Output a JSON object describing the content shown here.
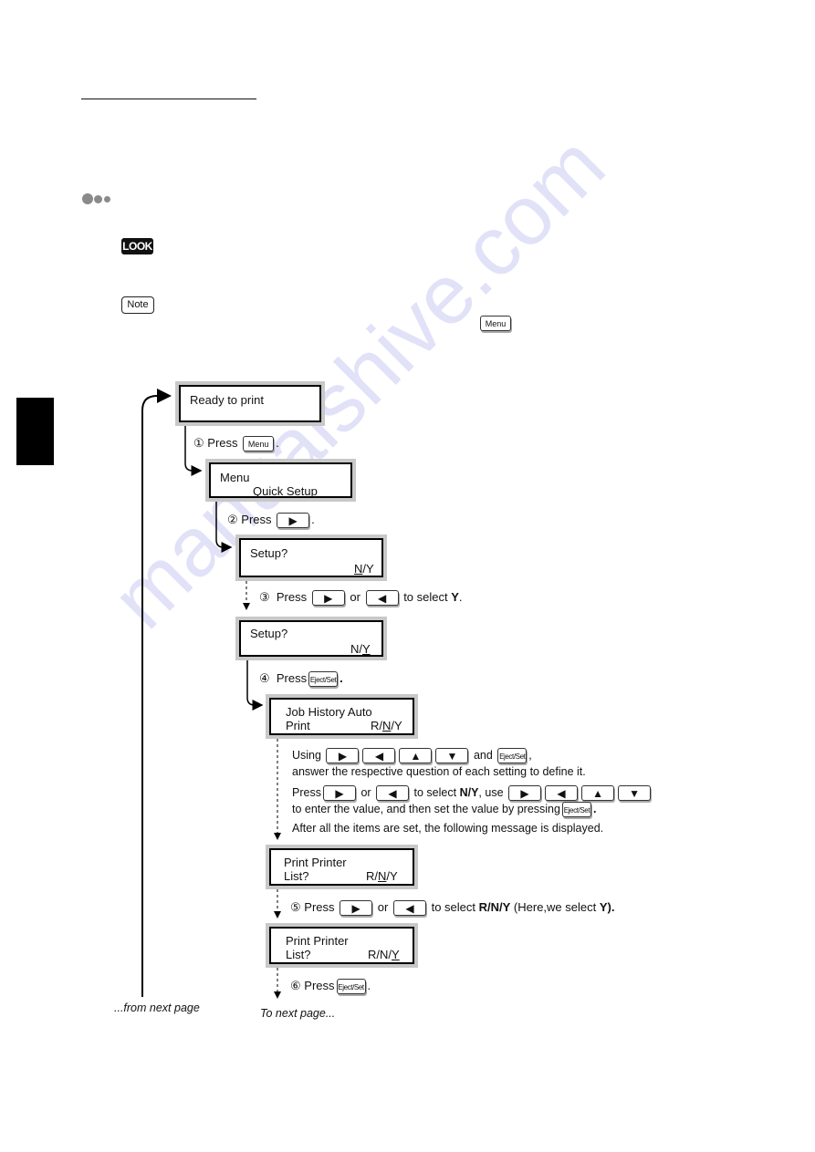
{
  "page": {
    "badges": {
      "look": "LOOK",
      "note": "Note"
    },
    "note_key": "Menu",
    "watermark": "manualshive.com"
  },
  "flow": {
    "screens": [
      {
        "line1": "Ready to print",
        "line2": ""
      },
      {
        "line1": "Menu",
        "line2": "Quick Setup"
      },
      {
        "line1": "Setup?",
        "line2_pre": "",
        "line2_u": "N",
        "line2_post": "/Y"
      },
      {
        "line1": "Setup?",
        "line2_pre": "N/",
        "line2_u": "Y",
        "line2_post": ""
      },
      {
        "line1": "Job History Auto",
        "line2_label": "Print",
        "line2_pre": "R/",
        "line2_u": "N",
        "line2_post": "/Y"
      },
      {
        "line1": "Print Printer",
        "line2_label": "List?",
        "line2_pre": "R/",
        "line2_u": "N",
        "line2_post": "/Y"
      },
      {
        "line1": "Print Printer",
        "line2_label": "List?",
        "line2_pre": "R/N/",
        "line2_u": "Y",
        "line2_post": ""
      }
    ],
    "steps": {
      "s1": {
        "num": "①",
        "press": "Press",
        "key": "Menu",
        "end": "."
      },
      "s2": {
        "num": "②",
        "press": "Press",
        "key": "▶",
        "end": "."
      },
      "s3": {
        "num": "③",
        "press": "Press",
        "key1": "▶",
        "or": "or",
        "key2": "◀",
        "to_select": "to select",
        "value": "Y",
        "end": "."
      },
      "s4": {
        "num": "④",
        "press": "Press",
        "key": "Eject/Set",
        "end": "."
      },
      "s5": {
        "num": "⑤",
        "press": "Press",
        "key1": "▶",
        "or": "or",
        "key2": "◀",
        "to_select": "to select",
        "value": "R/N/Y",
        "mid": "(Here,we select",
        "value2": "Y",
        "end": ")."
      },
      "s6": {
        "num": "⑥",
        "press": "Press",
        "key": "Eject/Set",
        "end": "."
      }
    },
    "instructions": {
      "using": "Using",
      "and": "and",
      "comma": ",",
      "line2": "answer the respective question of each setting to define it.",
      "press": "Press",
      "or": "or",
      "to_select": "to select",
      "ny": "N/Y",
      "use": ", use",
      "line4": "to enter the value, and then set the value by pressing",
      "line5": "After all the items are set, the following message is displayed.",
      "keys": {
        "right": "▶",
        "left": "◀",
        "up": "▲",
        "down": "▼",
        "eject": "Eject/Set"
      }
    },
    "from_next_page": "...from next page",
    "to_next_page": "To next page..."
  }
}
